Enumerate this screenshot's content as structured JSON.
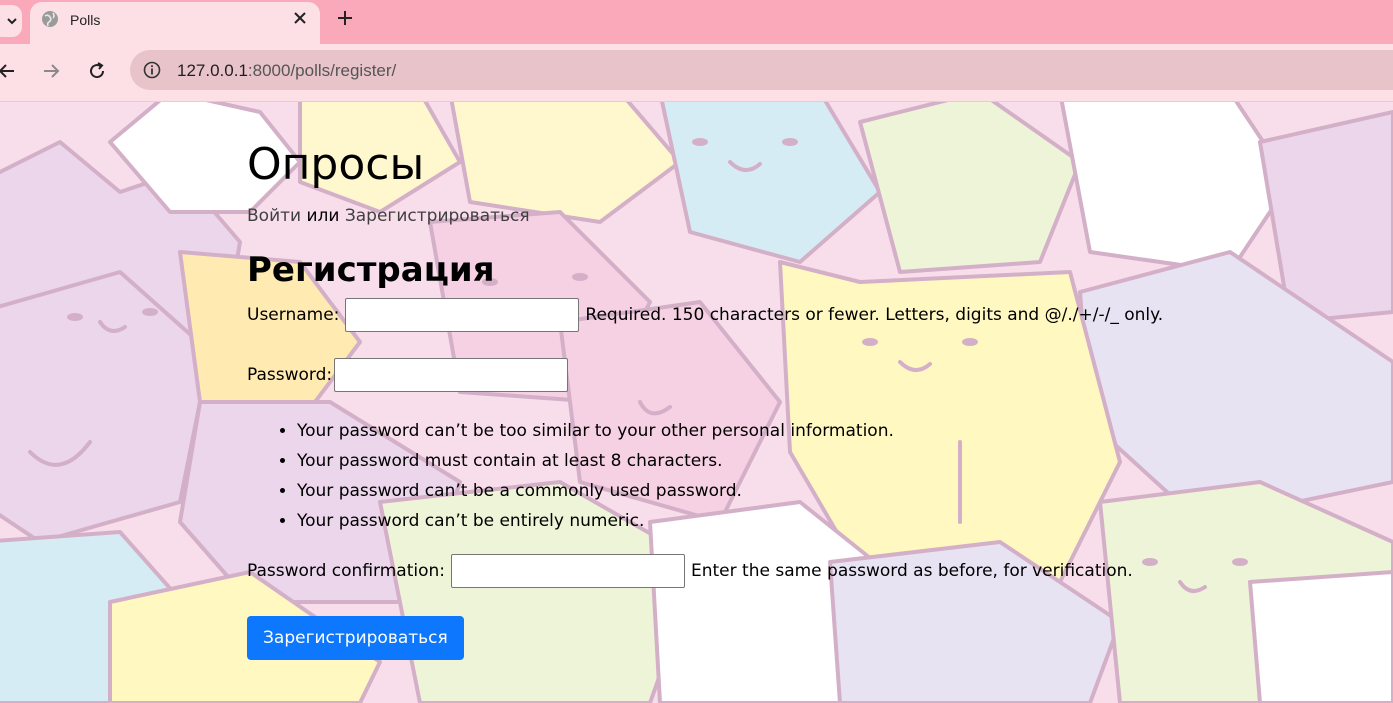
{
  "browser": {
    "tab_title": "Polls",
    "url_host": "127.0.0.1",
    "url_rest": ":8000/polls/register/"
  },
  "page": {
    "site_title": "Опросы",
    "login_link": "Войти",
    "or_text": " или ",
    "register_link": "Зарегистрироваться",
    "form_title": "Регистрация",
    "username_label": "Username:",
    "username_value": "",
    "username_help": "Required. 150 characters or fewer. Letters, digits and @/./+/-/_ only.",
    "password_label": "Password:",
    "password_value": "",
    "password_help": [
      "Your password can’t be too similar to your other personal information.",
      "Your password must contain at least 8 characters.",
      "Your password can’t be a commonly used password.",
      "Your password can’t be entirely numeric."
    ],
    "confirm_label": "Password confirmation:",
    "confirm_value": "",
    "confirm_help": "Enter the same password as before, for verification.",
    "submit_label": "Зарегистрироваться"
  },
  "colors": {
    "tabbar_bg": "#f9a9b9",
    "toolbar_bg": "#fde0e6",
    "submit_bg": "#0d77fd"
  },
  "icons": [
    "tab-list-icon",
    "globe-icon",
    "close-icon",
    "plus-icon",
    "back-arrow-icon",
    "forward-arrow-icon",
    "reload-icon",
    "info-icon"
  ]
}
